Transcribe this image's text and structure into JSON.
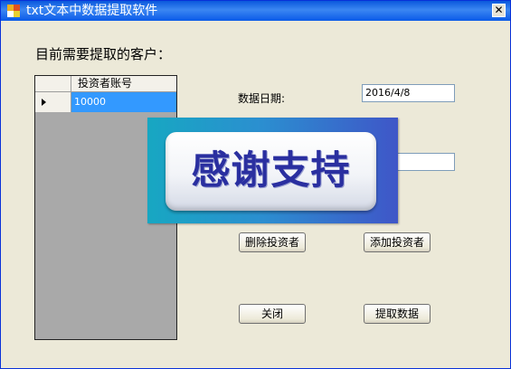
{
  "window": {
    "title": "txt文本中数据提取软件",
    "close_glyph": "✕"
  },
  "main": {
    "prompt": "目前需要提取的客户："
  },
  "grid": {
    "column_header": "投资者账号",
    "rows": [
      {
        "value": "10000",
        "selected": true
      }
    ]
  },
  "form": {
    "date_label": "数据日期:",
    "date_value": "2016/4/8",
    "investor_value": ""
  },
  "buttons": {
    "delete_investor": "删除投资者",
    "add_investor": "添加投资者",
    "close": "关闭",
    "extract": "提取数据"
  },
  "banner": {
    "text": "感谢支持"
  },
  "colors": {
    "titlebar": "#0a58dc",
    "selection": "#3399ff",
    "window_bg": "#ece9d8",
    "banner_text": "#2a2fa0"
  },
  "icons": {
    "app": "windows-form-icon",
    "close": "close-icon",
    "row_pointer": "row-pointer-icon"
  }
}
